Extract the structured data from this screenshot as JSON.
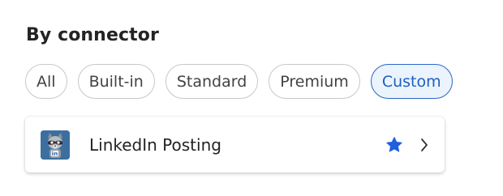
{
  "section": {
    "heading": "By connector"
  },
  "filters": [
    {
      "label": "All",
      "selected": false
    },
    {
      "label": "Built-in",
      "selected": false
    },
    {
      "label": "Standard",
      "selected": false
    },
    {
      "label": "Premium",
      "selected": false
    },
    {
      "label": "Custom",
      "selected": true
    }
  ],
  "connectors": [
    {
      "name": "LinkedIn Posting",
      "icon": "raccoon-linkedin-logo-icon",
      "favorite": true,
      "action_icon": "chevron-right-icon"
    }
  ],
  "colors": {
    "accent": "#2c66c9",
    "selected_bg": "#ebf3fc",
    "star": "#1f5fe0",
    "logo_bg": "#3c6fa0"
  }
}
